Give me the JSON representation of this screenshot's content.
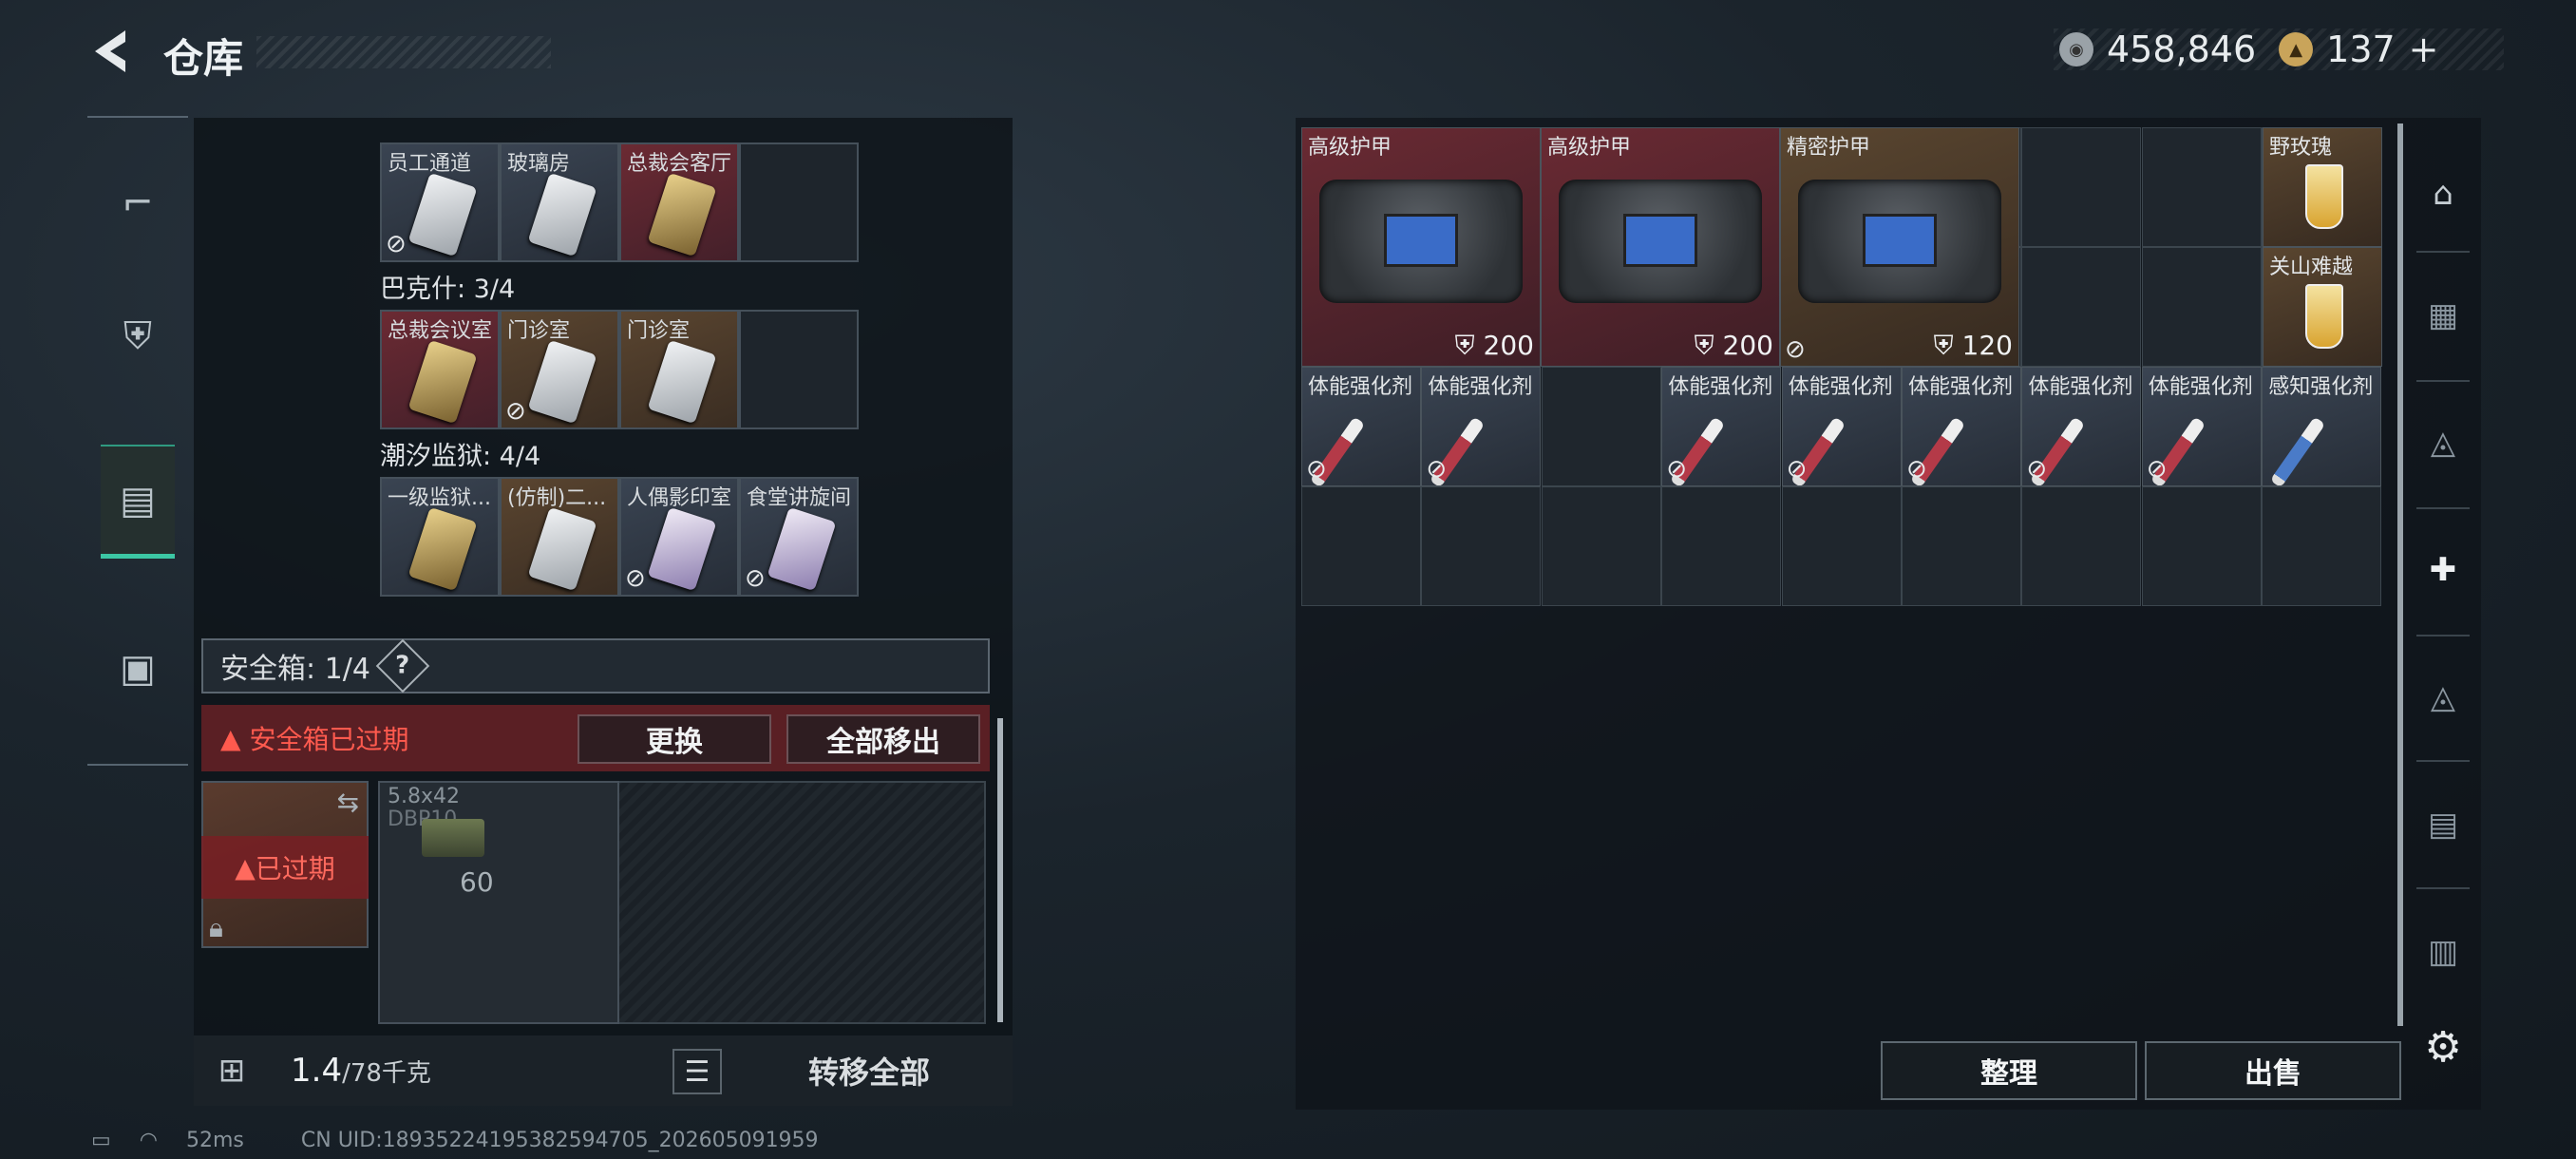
{
  "header": {
    "title": "仓库"
  },
  "currency": {
    "silver": "458,846",
    "gold": "137",
    "plus": "+"
  },
  "keycards": {
    "row0": [
      "员工通道",
      "玻璃房",
      "总裁会客厅"
    ],
    "group1": {
      "label": "巴克什: 3/4",
      "items": [
        "总裁会议室",
        "门诊室",
        "门诊室"
      ]
    },
    "group2": {
      "label": "潮汐监狱: 4/4",
      "items": [
        "一级监狱...",
        "(仿制)二...",
        "人偶影印室",
        "食堂讲旋间"
      ]
    }
  },
  "safebox": {
    "label": "安全箱: 1/4",
    "help": "?",
    "expired_text": "安全箱已过期",
    "replace_btn": "更换",
    "move_all_btn": "全部移出",
    "box_expired": "已过期"
  },
  "ammo": {
    "name": "5.8x42",
    "sub": "DBP10",
    "count": "60"
  },
  "weight": {
    "current": "1.4",
    "max": "/78千克",
    "transfer_btn": "转移全部",
    "lock_label": "KG"
  },
  "stash": {
    "armor": [
      {
        "name": "高级护甲",
        "dur": "200"
      },
      {
        "name": "高级护甲",
        "dur": "200"
      },
      {
        "name": "精密护甲",
        "dur": "120"
      }
    ],
    "drinks": [
      "野玫瑰",
      "关山难越"
    ],
    "injectors": [
      "体能强化剂",
      "体能强化剂",
      "",
      "体能强化剂",
      "体能强化剂",
      "体能强化剂",
      "体能强化剂",
      "体能强化剂",
      "感知强化剂"
    ],
    "sort_btn": "整理",
    "sell_btn": "出售"
  },
  "status": {
    "ping": "52ms",
    "uid": "CN UID:1893522419538259470​5_202605091959"
  }
}
